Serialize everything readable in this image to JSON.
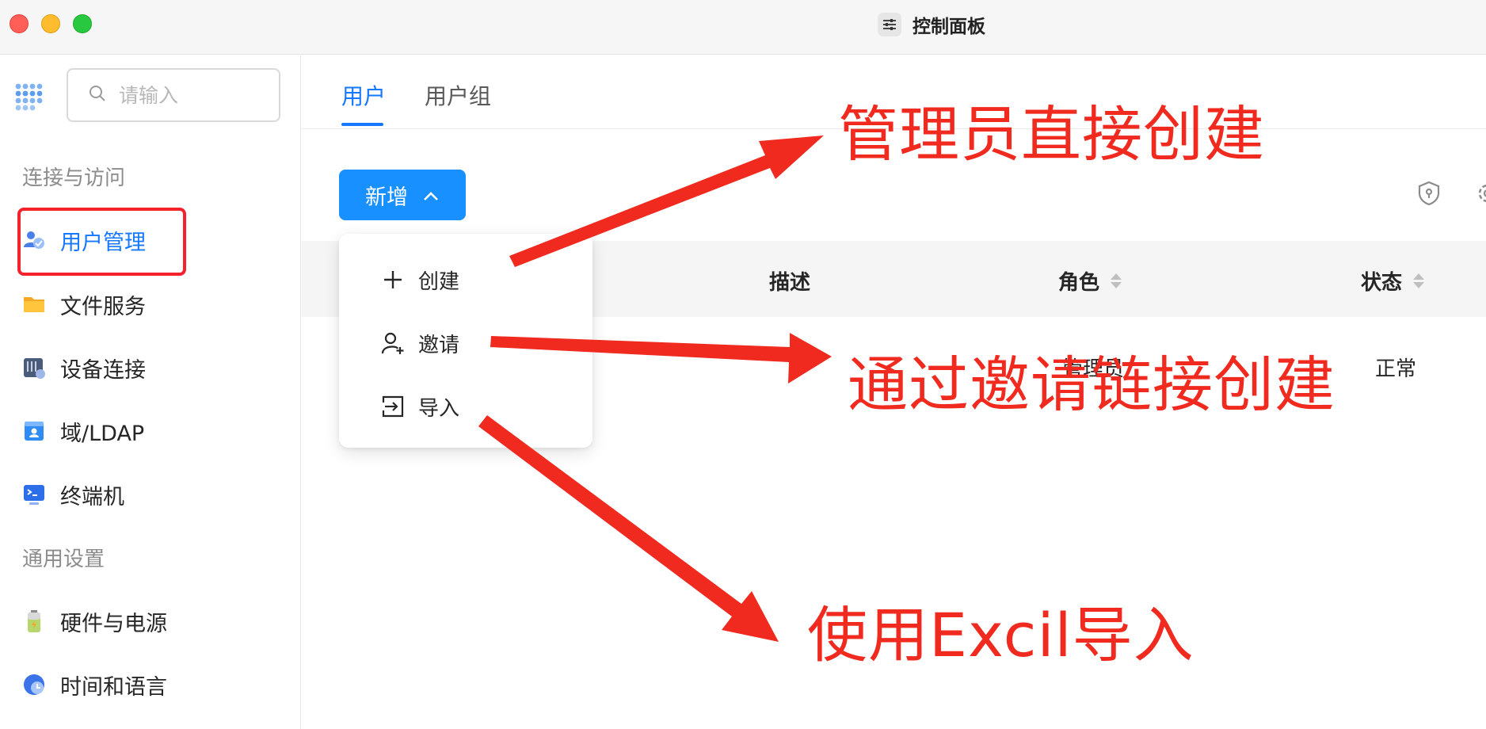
{
  "window": {
    "title": "控制面板",
    "app_icon": "sliders-icon"
  },
  "sidebar": {
    "search_placeholder": "请输入",
    "sections": [
      {
        "label": "连接与访问"
      },
      {
        "label": "通用设置"
      }
    ],
    "items": [
      {
        "label": "用户管理",
        "icon": "users-icon",
        "active": true
      },
      {
        "label": "文件服务",
        "icon": "folder-icon"
      },
      {
        "label": "设备连接",
        "icon": "device-icon"
      },
      {
        "label": "域/LDAP",
        "icon": "directory-icon"
      },
      {
        "label": "终端机",
        "icon": "terminal-icon"
      },
      {
        "label": "硬件与电源",
        "icon": "battery-icon"
      },
      {
        "label": "时间和语言",
        "icon": "clock-icon"
      }
    ]
  },
  "main": {
    "tabs": [
      {
        "label": "用户",
        "active": true
      },
      {
        "label": "用户组"
      }
    ],
    "add_button": {
      "label": "新增",
      "icon": "chevron-up-icon"
    },
    "dropdown": [
      {
        "label": "创建",
        "icon": "plus-icon"
      },
      {
        "label": "邀请",
        "icon": "add-user-icon"
      },
      {
        "label": "导入",
        "icon": "import-icon"
      }
    ],
    "toolbar_icons": [
      "shield-icon",
      "gear-icon"
    ],
    "table": {
      "columns": [
        {
          "label": "描述",
          "sortable": false
        },
        {
          "label": "角色",
          "sortable": true
        },
        {
          "label": "状态",
          "sortable": true
        }
      ],
      "rows": [
        {
          "role": "管理员",
          "status": "正常"
        }
      ]
    }
  },
  "annotations": {
    "color": "#f02a1f",
    "notes": [
      "管理员直接创建",
      "通过邀请链接创建",
      "使用Excil导入"
    ]
  }
}
